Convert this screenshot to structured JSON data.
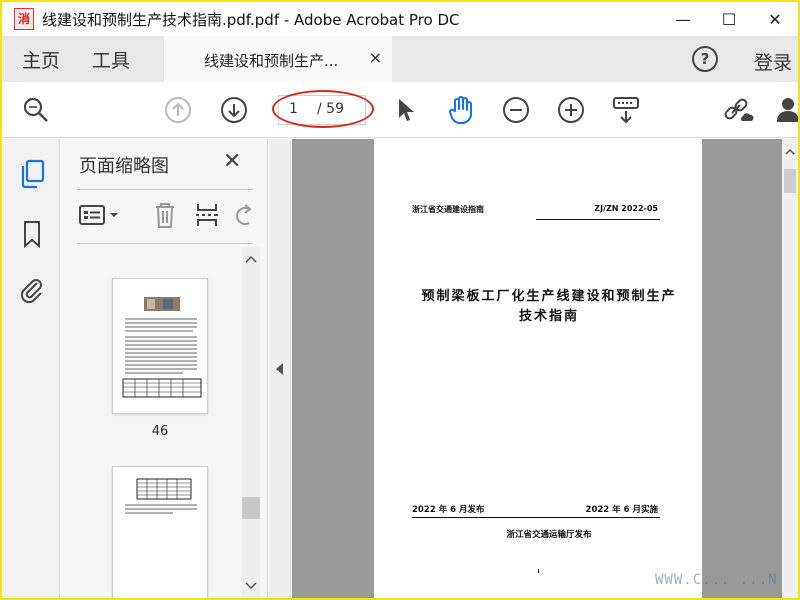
{
  "window": {
    "title": "线建设和预制生产技术指南.pdf.pdf - Adobe Acrobat Pro DC",
    "app_icon_char": "消",
    "minimize_glyph": "—",
    "maximize_glyph": "☐",
    "close_glyph": "✕"
  },
  "menu": {
    "home": "主页",
    "tools": "工具",
    "doc_tab": "线建设和预制生产...",
    "doc_tab_close": "×",
    "help_glyph": "?",
    "login": "登录"
  },
  "toolbar": {
    "icons": [
      "search-zoom-icon",
      "page-up-icon",
      "page-down-icon",
      "select-cursor-icon",
      "hand-tool-icon",
      "zoom-out-icon",
      "zoom-in-icon",
      "keyboard-scroll-icon",
      "share-link-icon",
      "user-icon"
    ],
    "current_page": "1",
    "total_pages": "/ 59"
  },
  "side_rail": {
    "icons": [
      "page-thumbnails-icon",
      "bookmark-icon",
      "attachment-icon"
    ]
  },
  "thumbnails_panel": {
    "title": "页面缩略图",
    "close_glyph": "✕",
    "tools": [
      "thumbnail-options-icon",
      "delete-page-icon",
      "insert-page-icon",
      "rotate-page-icon"
    ],
    "items": [
      {
        "label": "46"
      },
      {
        "label": ""
      }
    ]
  },
  "document": {
    "header_left": "浙江省交通建设指南",
    "header_right": "ZJ/ZN 2022-05",
    "title_line1": "预制梁板工厂化生产线建设和预制生产",
    "title_line2": "技术指南",
    "publish_date": "2022 年 6 月发布",
    "implement_date": "2022 年 6 月实施",
    "publisher": "浙江省交通运输厅发布"
  },
  "watermark": "WWW.C... ...N",
  "colors": {
    "frame": "#f2e313",
    "accent_blue": "#1473e6",
    "annotation_red": "#d9261c"
  }
}
